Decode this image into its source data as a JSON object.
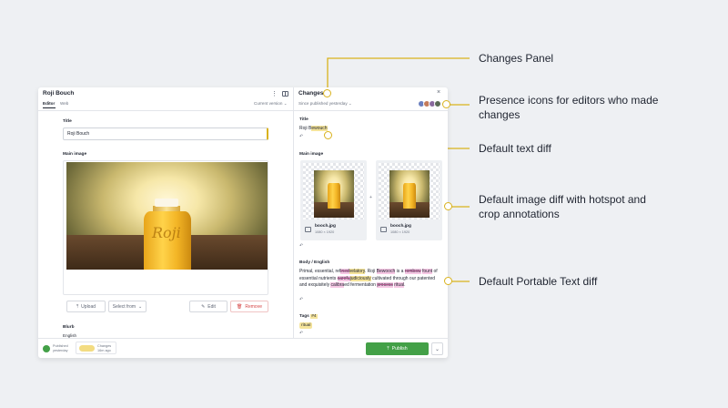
{
  "editor": {
    "doc_title": "Roji Bouch",
    "tabs": [
      "Editor",
      "Web"
    ],
    "version_label": "Current version",
    "title_label": "Title",
    "title_value": "Roji Bouch",
    "main_image_label": "Main image",
    "bottle_text": "Roji",
    "upload_label": "Upload",
    "select_from_label": "Select from",
    "edit_label": "Edit",
    "remove_label": "Remove",
    "blurb_label": "Blurb",
    "blurb_sub": "English"
  },
  "changes": {
    "header": "Changes",
    "since_label": "Since published yesterday",
    "title_label": "Title",
    "title_prefix": "Roji B",
    "title_added": "ewouch",
    "main_image_label": "Main image",
    "plus": "+",
    "images": [
      {
        "filename": "booch.jpg",
        "dims": "1080 × 1920"
      },
      {
        "filename": "booch.jpg",
        "dims": "1080 × 1920"
      }
    ],
    "body_label": "Body / English",
    "body_segments": [
      {
        "t": "Primal, essential, ref",
        "s": "plain"
      },
      {
        "t": "ined",
        "s": "del"
      },
      {
        "t": "velatory",
        "s": "add"
      },
      {
        "t": ". Roji ",
        "s": "plain"
      },
      {
        "t": "Bewooch",
        "s": "pink"
      },
      {
        "t": " is a ",
        "s": "plain"
      },
      {
        "t": "rembow",
        "s": "del"
      },
      {
        "t": " ",
        "s": "plain"
      },
      {
        "t": "fount",
        "s": "pink"
      },
      {
        "t": " of essential nutrients ",
        "s": "plain"
      },
      {
        "t": "carefu",
        "s": "del"
      },
      {
        "t": "judiciously",
        "s": "add"
      },
      {
        "t": " cultivated through our patented and exquisitely ",
        "s": "plain"
      },
      {
        "t": "calibra",
        "s": "pink"
      },
      {
        "t": "ed fermentation ",
        "s": "plain"
      },
      {
        "t": "process",
        "s": "del"
      },
      {
        "t": " ",
        "s": "plain"
      },
      {
        "t": "ritual",
        "s": "pink"
      },
      {
        "t": ".",
        "s": "plain"
      }
    ],
    "tags_label": "Tags",
    "tags_count": "#4",
    "tag_value": "ritual"
  },
  "footer": {
    "published_label": "Published",
    "published_when": "yesterday",
    "changes_label": "Changes",
    "changes_when": "16m ago",
    "publish_button": "Publish"
  },
  "annotations": [
    {
      "id": "changes-panel",
      "text": "Changes Panel"
    },
    {
      "id": "presence",
      "text": "Presence icons for editors who made changes"
    },
    {
      "id": "text-diff",
      "text": "Default text diff"
    },
    {
      "id": "image-diff",
      "text": "Default image diff with hotspot and crop annotations"
    },
    {
      "id": "pt-diff",
      "text": "Default Portable Text diff"
    }
  ],
  "colors": {
    "accent_yellow": "#d9b21c",
    "publish_green": "#43a047",
    "added_highlight": "#f5e49b",
    "removed_highlight": "#f6c7e4"
  }
}
